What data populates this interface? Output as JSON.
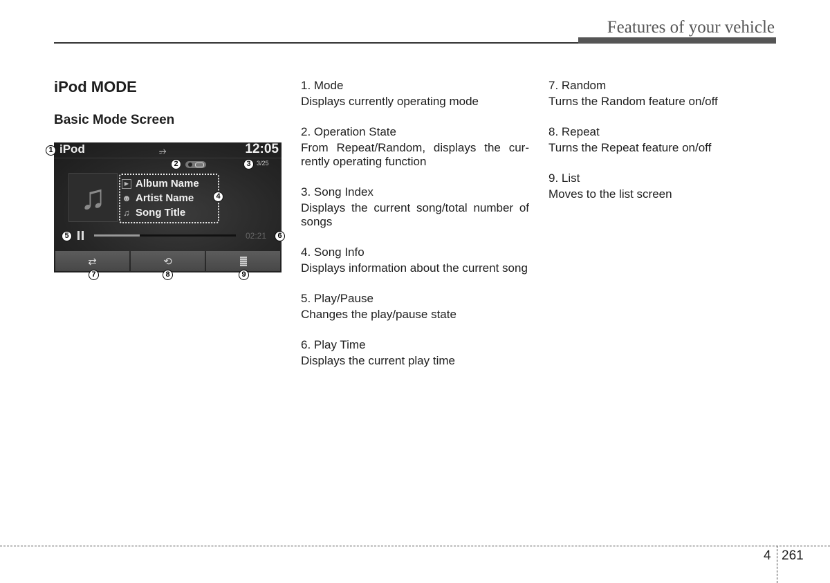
{
  "header": {
    "title": "Features of your vehicle"
  },
  "section": {
    "title": "iPod MODE",
    "subtitle": "Basic Mode Screen"
  },
  "screen": {
    "mode": "iPod",
    "clock": "12:05",
    "song_index": "3/25",
    "album": "Album Name",
    "artist": "Artist Name",
    "song": "Song Title",
    "play_time": "02:21",
    "progress_fraction": 0.32,
    "icons": {
      "usb": "usb-icon",
      "shuffle": "shuffle-icon",
      "repeat": "repeat-icon",
      "list": "list-icon"
    },
    "callouts": [
      "1",
      "2",
      "3",
      "4",
      "5",
      "6",
      "7",
      "8",
      "9"
    ]
  },
  "items": [
    {
      "title": "1. Mode",
      "desc": "Displays currently operating mode"
    },
    {
      "title": "2. Operation State",
      "desc": "From Repeat/Random, displays the cur-rently operating function"
    },
    {
      "title": "3. Song Index",
      "desc": "Displays the current song/total number of songs"
    },
    {
      "title": "4. Song Info",
      "desc": "Displays information about the current song"
    },
    {
      "title": "5. Play/Pause",
      "desc": "Changes the play/pause state"
    },
    {
      "title": "6. Play Time",
      "desc": "Displays the current play time"
    },
    {
      "title": "7. Random",
      "desc": "Turns the Random feature on/off"
    },
    {
      "title": "8. Repeat",
      "desc": "Turns the Repeat feature on/off"
    },
    {
      "title": "9. List",
      "desc": "Moves to the list screen"
    }
  ],
  "footer": {
    "chapter": "4",
    "page": "261"
  }
}
